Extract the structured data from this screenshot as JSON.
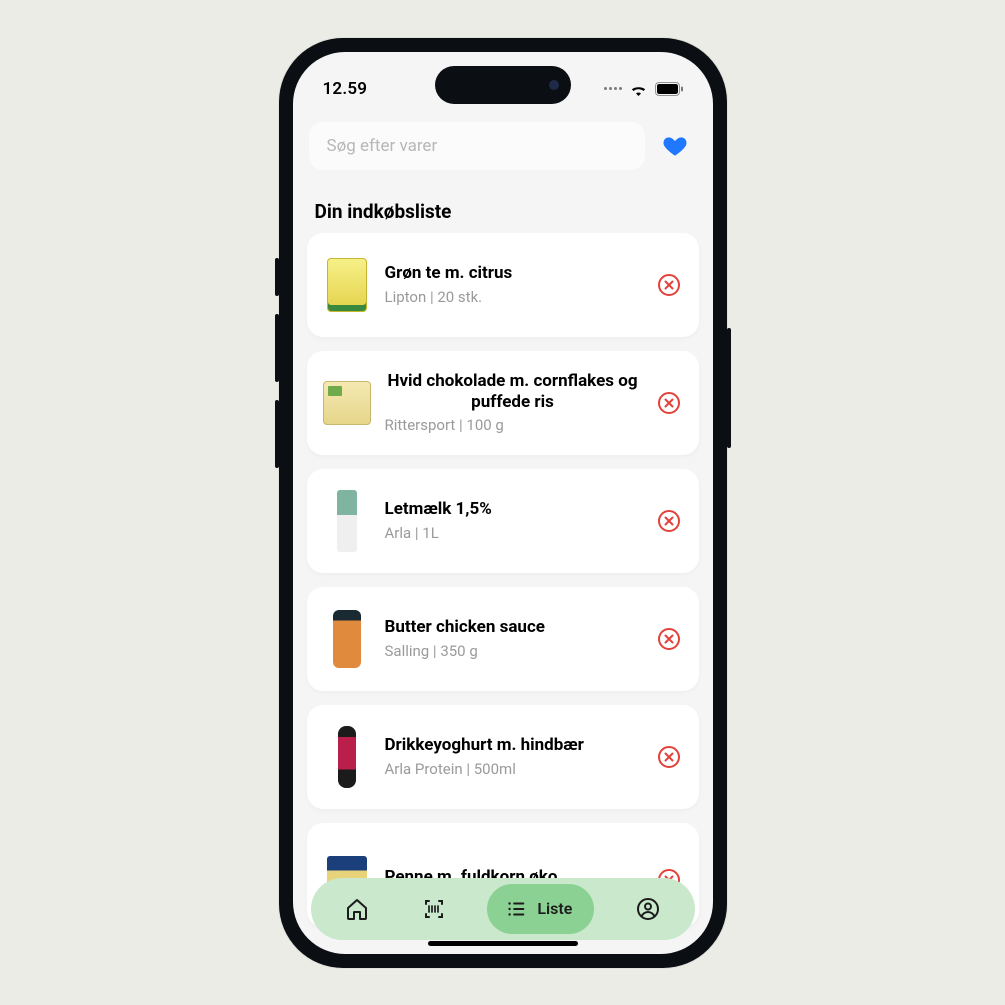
{
  "status": {
    "time": "12.59"
  },
  "search": {
    "placeholder": "Søg efter varer"
  },
  "section_title": "Din indkøbsliste",
  "items": [
    {
      "title": "Grøn te m. citrus",
      "sub": "Lipton  |  20 stk."
    },
    {
      "title": "Hvid chokolade m. cornflakes og puffede ris",
      "sub": "Rittersport  |  100 g"
    },
    {
      "title": "Letmælk 1,5%",
      "sub": "Arla  |  1L"
    },
    {
      "title": "Butter chicken sauce",
      "sub": "Salling  |  350 g"
    },
    {
      "title": "Drikkeyoghurt m. hindbær",
      "sub": "Arla Protein  |  500ml"
    },
    {
      "title": "Penne m. fuldkorn øko",
      "sub": ""
    }
  ],
  "nav": {
    "active_label": "Liste"
  },
  "colors": {
    "accent": "#1f78ff",
    "danger": "#e3423a",
    "nav_bg": "#cae8cc",
    "nav_pill": "#8bd193"
  }
}
